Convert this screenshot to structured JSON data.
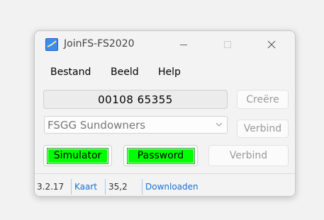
{
  "window": {
    "title": "JoinFS-FS2020"
  },
  "menu": [
    {
      "label": "Bestand"
    },
    {
      "label": "Beeld"
    },
    {
      "label": "Help"
    }
  ],
  "session": {
    "code": "00108 65355",
    "create_label": "Creëre"
  },
  "group": {
    "selected": "FSGG Sundowners",
    "connect_label": "Verbind"
  },
  "status_buttons": {
    "simulator": "Simulator",
    "password": "Password",
    "connect": "Verbind",
    "indicator_color": "#00ff00"
  },
  "statusbar": {
    "version": "3.2.17",
    "map_link": "Kaart",
    "value": "35,2",
    "download_link": "Downloaden"
  }
}
